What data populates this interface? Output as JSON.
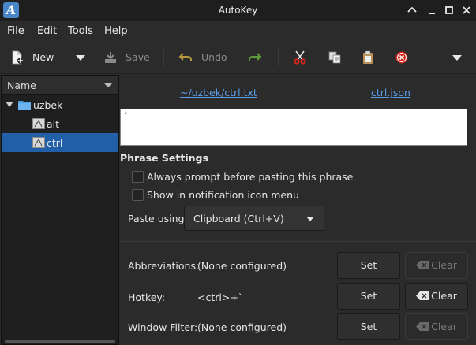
{
  "window": {
    "title": "AutoKey",
    "app_icon_letter": "A"
  },
  "menubar": {
    "items": [
      "File",
      "Edit",
      "Tools",
      "Help"
    ]
  },
  "toolbar": {
    "new_label": "New",
    "save_label": "Save",
    "undo_label": "Undo"
  },
  "tree": {
    "header": "Name",
    "rows": [
      {
        "label": "uzbek",
        "type": "folder"
      },
      {
        "label": "alt",
        "type": "phrase"
      },
      {
        "label": "ctrl",
        "type": "phrase",
        "selected": true
      }
    ]
  },
  "detail": {
    "file_link": "~/uzbek/ctrl.txt",
    "json_link": "ctrl.json",
    "phrase_text": "ʻ",
    "section_title": "Phrase Settings",
    "always_prompt_label": "Always prompt before pasting this phrase",
    "notification_label": "Show in notification icon menu",
    "paste_using_label": "Paste using",
    "paste_using_value": "Clipboard (Ctrl+V)",
    "abbreviations_label": "Abbreviations:",
    "abbreviations_value": "(None configured)",
    "hotkey_label": "Hotkey:",
    "hotkey_value": "<ctrl>+`",
    "window_filter_label": "Window Filter:",
    "window_filter_value": "(None configured)",
    "set_label": "Set",
    "clear_label": "Clear"
  },
  "colors": {
    "selection": "#2160a8",
    "link": "#5a9ee8",
    "cut_icon": "#d9261c",
    "stop_icon": "#d9261c"
  }
}
